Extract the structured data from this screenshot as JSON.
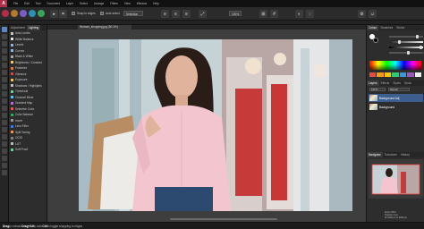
{
  "app": {
    "logo_letter": "A"
  },
  "menu": {
    "items": [
      "File",
      "Edit",
      "Text",
      "Document",
      "Layer",
      "Select",
      "Arrange",
      "Filters",
      "View",
      "Window",
      "Help"
    ]
  },
  "toolbar": {
    "snap_label": "Snap to edges",
    "auto_select_label": "Auto select",
    "combo_label": "Selection",
    "zoom_label": "100%"
  },
  "adjustments": {
    "tabs": [
      "Adjustment",
      "Lighting"
    ],
    "items": [
      {
        "label": "Auto Levels",
        "color": "#c9c9c9"
      },
      {
        "label": "White Balance",
        "color": "#e6e6e6"
      },
      {
        "label": "Levels",
        "color": "#9bb6d8"
      },
      {
        "label": "Curves",
        "color": "#8fb9e2"
      },
      {
        "label": "Black & White",
        "color": "#aaaaaa"
      },
      {
        "label": "Brightness / Contrast",
        "color": "#f0d060"
      },
      {
        "label": "Posterize",
        "color": "#e07b39"
      },
      {
        "label": "Vibrance",
        "color": "#d84a4a"
      },
      {
        "label": "Exposure",
        "color": "#f2c94c"
      },
      {
        "label": "Shadows / Highlights",
        "color": "#c0c0c0"
      },
      {
        "label": "Threshold",
        "color": "#6fcf97"
      },
      {
        "label": "Channel Mixer",
        "color": "#56ccf2"
      },
      {
        "label": "Gradient Map",
        "color": "#bb6bd9"
      },
      {
        "label": "Selective Color",
        "color": "#eb5757"
      },
      {
        "label": "Color Balance",
        "color": "#27ae60"
      },
      {
        "label": "Invert",
        "color": "#9b9b9b"
      },
      {
        "label": "Lens Filter",
        "color": "#2f80ed"
      },
      {
        "label": "Split Toning",
        "color": "#f2994a"
      },
      {
        "label": "OCIO",
        "color": "#828282"
      },
      {
        "label": "LUT",
        "color": "#bdbdbd"
      },
      {
        "label": "Soft Proof",
        "color": "#6fcf97"
      }
    ]
  },
  "document": {
    "tab_title": "Woman_shopping.jpg (50.1%)"
  },
  "right_panel": {
    "color_tabs": [
      "Colour",
      "Swatches",
      "Stroke"
    ],
    "layer_tabs": [
      "Layers",
      "Effects",
      "Styles",
      "Stock"
    ],
    "opacity_label": "100 %",
    "blend_label": "Normal",
    "layers": [
      {
        "name": "Background Adj",
        "selected": true
      },
      {
        "name": "Background",
        "selected": false
      }
    ],
    "nav_tabs": [
      "Navigator",
      "Transform",
      "History"
    ],
    "nav_info": [
      "Zoom 50%",
      "Position 0 px",
      "W 3000 px H 2000 px"
    ]
  },
  "status": {
    "text_parts": [
      {
        "bold": true,
        "text": "Drag"
      },
      {
        "bold": false,
        "text": " to extract. "
      },
      {
        "bold": true,
        "text": "Drag+Alt"
      },
      {
        "bold": false,
        "text": " to add. "
      },
      {
        "bold": true,
        "text": "Ctrl"
      },
      {
        "bold": false,
        "text": " to toggle snapping to edges"
      }
    ]
  },
  "colors": {
    "accent": "#5d87c4",
    "brand": "#b32d4b",
    "layer_selected": "#3d5f8f"
  }
}
